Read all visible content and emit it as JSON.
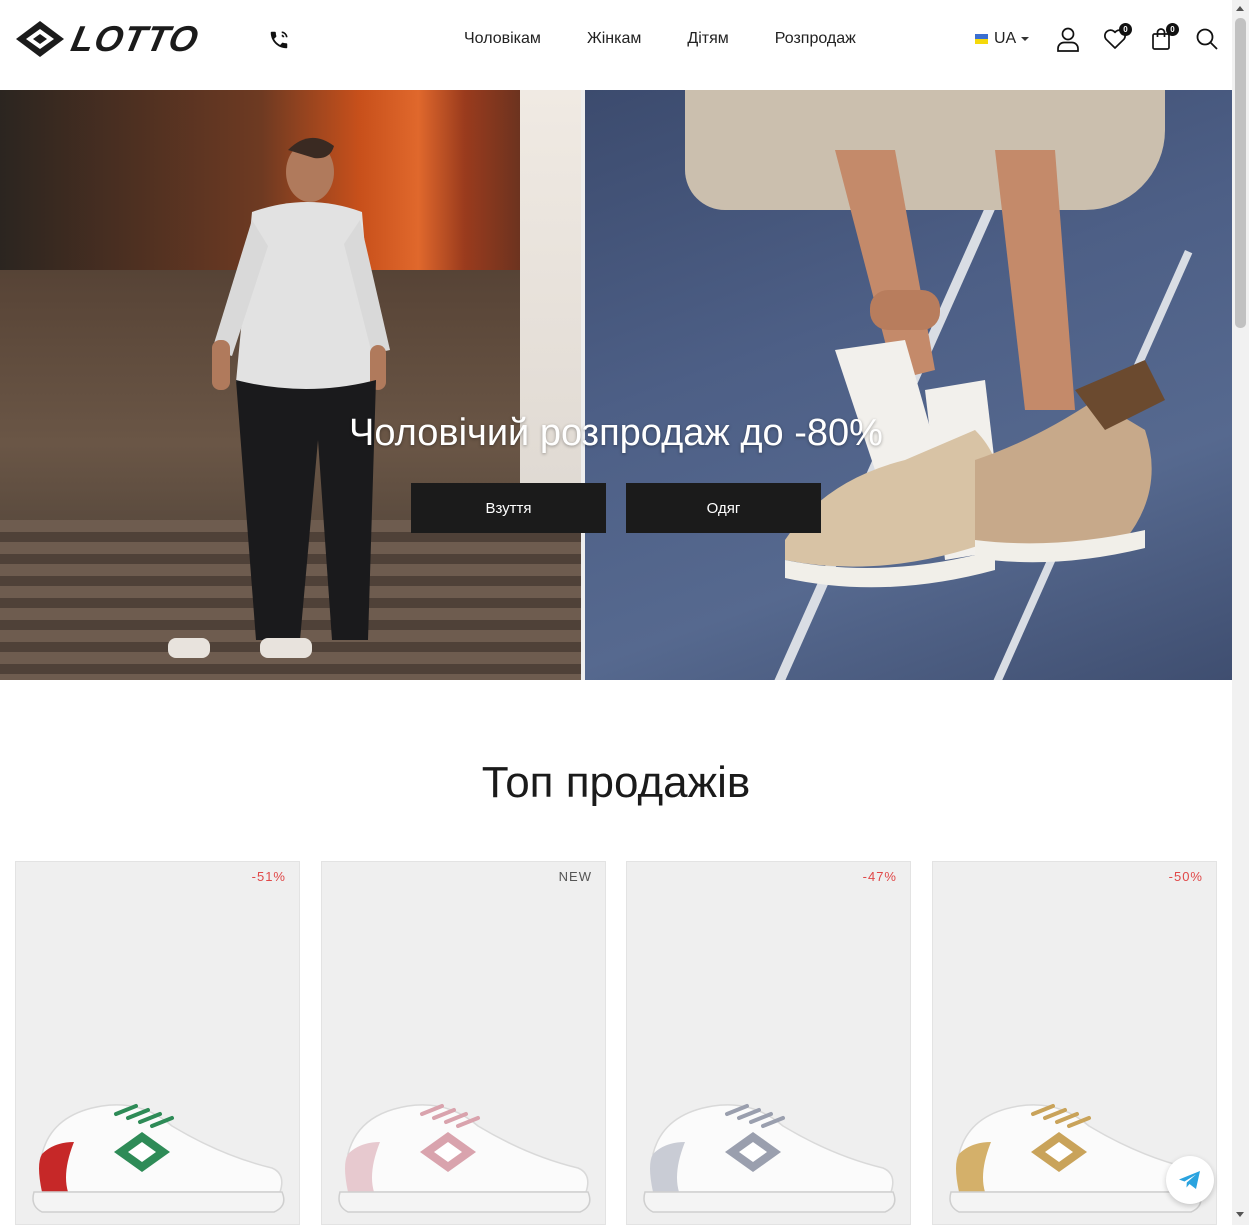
{
  "brand": {
    "name": "LOTTO"
  },
  "nav": {
    "items": [
      {
        "label": "Чоловікам"
      },
      {
        "label": "Жінкам"
      },
      {
        "label": "Дітям"
      },
      {
        "label": "Розпродаж"
      }
    ]
  },
  "header": {
    "language": "UA",
    "wishlist_count": "0",
    "cart_count": "0",
    "icons": [
      "phone-icon",
      "user-icon",
      "heart-icon",
      "bag-icon",
      "search-icon"
    ]
  },
  "hero": {
    "title": "Чоловічий розпродаж до -80%",
    "buttons": [
      {
        "label": "Взуття"
      },
      {
        "label": "Одяг"
      }
    ]
  },
  "top_sales": {
    "title": "Топ продажів",
    "products": [
      {
        "tag": "-51%",
        "tag_type": "sale",
        "accent": "#2e8b57",
        "heel": "#c62828"
      },
      {
        "tag": "NEW",
        "tag_type": "new",
        "accent": "#d9a3ad",
        "heel": "#e7c9cf"
      },
      {
        "tag": "-47%",
        "tag_type": "sale",
        "accent": "#9a9fae",
        "heel": "#c9ccd5"
      },
      {
        "tag": "-50%",
        "tag_type": "sale",
        "accent": "#c9a35a",
        "heel": "#d4b06a"
      }
    ]
  },
  "colors": {
    "accent_sale": "#e04848",
    "button_dark": "#1b1b1b",
    "telegram": "#2aa3df"
  }
}
